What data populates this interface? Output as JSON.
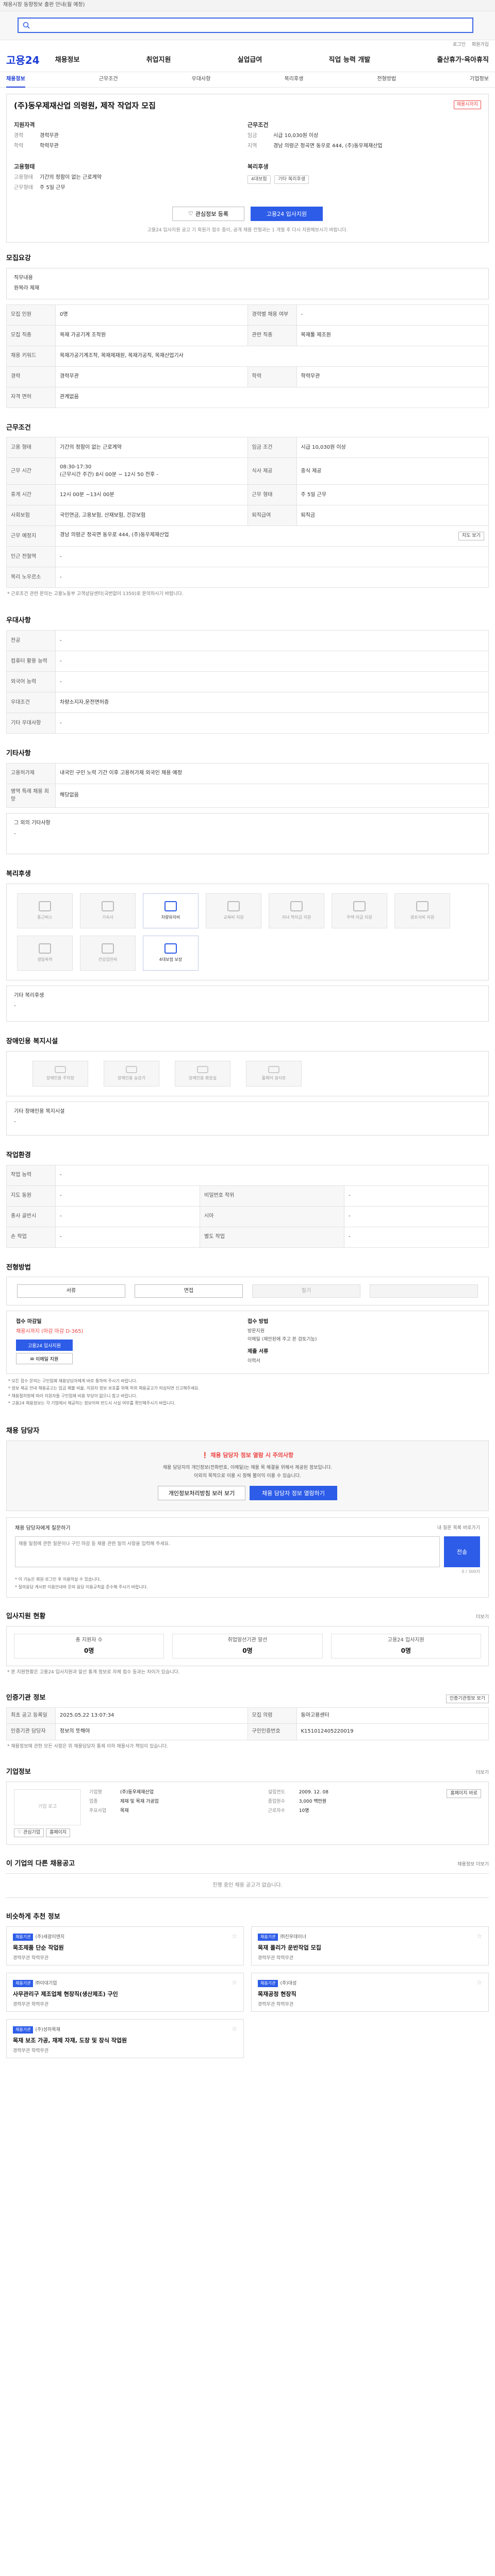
{
  "notice": "채용시장 동향정보 출판 안내(월 예정)",
  "search": {
    "placeholder": ""
  },
  "util": [
    "로그인",
    "회원가입"
  ],
  "logo": "고용24",
  "gnb": [
    "채용정보",
    "취업지원",
    "실업급여",
    "직업 능력 개발",
    "출산휴가·육아휴직"
  ],
  "subnav": [
    {
      "label": "채용정보",
      "active": true
    },
    {
      "label": "근무조건",
      "active": false
    },
    {
      "label": "우대사항",
      "active": false
    },
    {
      "label": "복리후생",
      "active": false
    },
    {
      "label": "전형방법",
      "active": false
    },
    {
      "label": "기업정보",
      "active": false
    }
  ],
  "job": {
    "title": "(주)동우제재산업 의령원, 제작 작업자 모집",
    "badge": "채용시까지",
    "left_head": "지원자격",
    "left": [
      {
        "k": "경력",
        "v": "경력무관"
      },
      {
        "k": "학력",
        "v": "학력무관"
      }
    ],
    "right_head": "근무조건",
    "right": [
      {
        "k": "임금",
        "v": "시급 10,030원 이상"
      },
      {
        "k": "지역",
        "v": "경남 의령군 정곡면 동우로 444, (주)동우제재산업"
      }
    ],
    "left2_head": "고용형태",
    "left2": [
      {
        "k": "고용형태",
        "v": "기간의 정함이 없는 근로계약"
      },
      {
        "k": "근무형태",
        "v": "주 5일 근무"
      }
    ],
    "right2_head": "복리후생",
    "chips": [
      "4대보험",
      "기타 복리후생"
    ],
    "btn_save": "관심정보 등록",
    "btn_apply": "고용24 입사지원",
    "note": "고용24 입사지원 공고 기 회원가 접수 중이, 공개 채용 전형과는 1 개월 후 다시 지원해보시기 바랍니다."
  },
  "sec_recruit": {
    "title": "모집요강",
    "lbl1": "직무내용",
    "val1": "원목라 제재",
    "rows": [
      [
        "모집 인원",
        "0명",
        "경력별 채용 여부",
        "-"
      ],
      [
        "모집 직종",
        "목재 가공기계 조작원",
        "관련 직종",
        "목재툴 제조원"
      ],
      [
        "채용 키워드",
        "목재가공기계조작, 목재제재원, 목재가공직, 목재산업기사",
        "",
        ""
      ],
      [
        "경력",
        "경력무관",
        "학력",
        "학력무관"
      ],
      [
        "자격 면허",
        "관계없음",
        "",
        ""
      ]
    ]
  },
  "sec_cond": {
    "title": "근무조건",
    "rows": [
      [
        "고용 형태",
        "기간의 정함이 없는 근로계약",
        "임금 조건",
        "시급 10,030원 이상"
      ],
      [
        "근무 시간",
        "08:30-17:30\n(근무시간 주간) 8시 00분 ~ 12시 50 전후 -",
        "식사 제공",
        "중식 제공"
      ],
      [
        "휴게 시간",
        "12시 00분 ~13시 00분",
        "근무 형태",
        "주 5일 근무"
      ],
      [
        "사회보험",
        "국민연금, 고용보험, 산재보험, 건강보험",
        "퇴직급여",
        "퇴직금"
      ],
      [
        "근무 예정지",
        "경남 의령군 정곡면 동우로 444, (주)동우제재산업",
        "",
        ""
      ],
      [
        "인근 전철역",
        "-",
        "",
        ""
      ],
      [
        "복리 노우르소",
        "-",
        "",
        ""
      ]
    ],
    "map_btn": "지도 보기",
    "footnote": "* 근로조건 관련 문의는 고용노동부 고객상담센터(국번없이 1350)로 문의하시기 바랍니다."
  },
  "sec_pref": {
    "title": "우대사항",
    "rows": [
      [
        "전공",
        "-"
      ],
      [
        "컴퓨터 활용 능력",
        "-"
      ],
      [
        "외국어 능력",
        "-"
      ],
      [
        "우대조건",
        "차량소지자,운전면허증"
      ],
      [
        "기타 우대사항",
        "-"
      ]
    ]
  },
  "sec_etc": {
    "title": "기타사항",
    "rows": [
      [
        "고용허가제",
        "내국인 구인 노력 기간 이후 고용허가제 외국인 채용 예정"
      ],
      [
        "병역 특례 채용 희망",
        "해당없음"
      ]
    ],
    "extra_lbl": "그 외의 기타사항",
    "extra_val": "-"
  },
  "sec_welfare": {
    "title": "복리후생",
    "items": [
      {
        "t": "통근버스",
        "on": false
      },
      {
        "t": "기숙사",
        "on": false
      },
      {
        "t": "차량유지비",
        "on": true
      },
      {
        "t": "교육비 지원",
        "on": false
      },
      {
        "t": "자녀 학자금 지원",
        "on": false
      },
      {
        "t": "주택 자금 지원",
        "on": false
      },
      {
        "t": "경조사비 지원",
        "on": false
      },
      {
        "t": "생일축하",
        "on": false
      },
      {
        "t": "건강검진비",
        "on": false
      },
      {
        "t": "4대보험 보장",
        "on": true
      }
    ],
    "etc_lbl": "기타 복리후생",
    "etc_val": "-"
  },
  "sec_disabled": {
    "title": "장애인용 복지시설",
    "items": [
      "장애인용 주차장",
      "장애인용 승강기",
      "장애인용 화장실",
      "휠체어 경사로"
    ],
    "etc_lbl": "기타 장애인용 복지시설",
    "etc_val": "-"
  },
  "sec_worktype": {
    "title": "작업환경",
    "rows": [
      [
        "작업 능력",
        "-",
        "",
        ""
      ],
      [
        "지도 동원",
        "-",
        "비밀번호 작위",
        "-"
      ],
      [
        "종사 골반시",
        "-",
        "시아",
        "-"
      ],
      [
        "손 작업",
        "-",
        "별도 작업",
        "-"
      ]
    ]
  },
  "sec_process": {
    "title": "전형방법",
    "steps": [
      {
        "t": "서류",
        "on": true
      },
      {
        "t": "면접",
        "on": true
      },
      {
        "t": "필기",
        "on": false
      },
      {
        "t": "",
        "on": false
      }
    ],
    "apply_h": "접수 마감일",
    "apply_d": "채용시까지 (마감 마감 D-365)",
    "apply_btn": "고용24 입사지원",
    "apply_btn2": "이메일 지원",
    "method_h": "접수 방법",
    "method_p": [
      "방문지원",
      "이메일 (제안된에 주고 본 검토기능)"
    ],
    "docs_h": "제출 서류",
    "docs_p": [
      "이력서"
    ],
    "notes": [
      "* 모든 접수 문의는 구인업체 채용당담자에게 바로 통하여 주시기 바랍니다.",
      "* 정보 제공 안내 채용공고는 임금 체불 비율, 지원자 정보 보호를 위해 허위 채용공고가 의심되면 신고해주세요.",
      "* 채용절차법에 따라 지원자들 구인업체 비용 부담이 없으니 참고 바랍니다.",
      "* 고용24 채용정보는 각 기업에서 제공하는 정보이며 반드시 사실 여부를 확인해주시기 바랍니다."
    ]
  },
  "sec_contact": {
    "title": "채용 담당자",
    "warn": "채용 담당자 정보 열람 시 주의사항",
    "lines": [
      "채용 담당자의 개인정보(전화번호, 이메일)는 채용 목 해결을 위해서 제공된 정보입니다.",
      "이외의 목적으로 이용 시 정해 불이익 이용 수 있습니다."
    ],
    "btn1": "개인정보처리방침 보러 보기",
    "btn2": "채용 담당자 정보 열람하기",
    "qa_title": "채용 담당자에게 질문하기",
    "qa_right": "내 질문 목록 바로가기",
    "qa_placeholder": "채용 일정에 관한 질문이나 구인 마감 등 채용 관련 질의 사항을 입력해 주세요.",
    "qa_btn": "전송",
    "qa_count": "0 / 300자",
    "qa_notes": [
      "* 이 기능은 회원 로그인 후 이용하실 수 있습니다.",
      "* 질의응답 게시판 이용안내와 문의 응답 이용규칙을 준수해 주시기 바랍니다."
    ]
  },
  "sec_status": {
    "title": "입사지원 현황",
    "more": "더보기",
    "items": [
      {
        "t": "총 지원자 수",
        "n": "0명"
      },
      {
        "t": "취업알선기관 알선",
        "n": "0명"
      },
      {
        "t": "고용24 입사지원",
        "n": "0명"
      }
    ],
    "note": "* 본 지원현황은 고용24 입사지원과 알선 통계 정보로 자체 접수 등과는 차이가 있습니다."
  },
  "sec_info": {
    "title": "인증기관 정보",
    "btn": "인증기관정보 보기",
    "rows": [
      [
        "최초 공고 등록일",
        "2025.05.22 13:07:34",
        "모집 의령",
        "동아고용센터"
      ],
      [
        "인증기관 담당자",
        "정보의 뜻해야",
        "구인인증번호",
        "K151012405220019"
      ]
    ],
    "footnote": "* 채용정보에 관한 모든 사항은 위 채용담당자 통제 이하 채용사가 책임이 있습니다."
  },
  "sec_company": {
    "title": "기업정보",
    "more": "더보기",
    "logo_alt": "기업 로고",
    "btn1": "관심기업",
    "btn2": "홈페이지",
    "info_left": [
      {
        "k": "기업명",
        "v": "(주)동우제재산업"
      },
      {
        "k": "업종",
        "v": "제재 및 목재 가공업"
      },
      {
        "k": "주요사업",
        "v": "목재"
      }
    ],
    "info_right": [
      {
        "k": "설립연도",
        "v": "2009. 12. 08"
      },
      {
        "k": "종업원수",
        "v": "3,000 백만원"
      },
      {
        "k": "근로자수",
        "v": "10명"
      }
    ],
    "homepage_btn": "홈페이지 바로"
  },
  "sec_other": {
    "title": "이 기업의 다른 채용공고",
    "more": "채용정보 더보기",
    "empty": "진행 중인 채용 공고가 없습니다."
  },
  "sec_rec": {
    "title": "비슷하게 추천 정보",
    "items": [
      {
        "tag": "채용기관",
        "co": "(주)세광이엔지",
        "title": "목조제품 단순 작업원",
        "meta": "경력무관  학력무관"
      },
      {
        "tag": "채용기관",
        "co": "㈜진우데이너",
        "title": "목재 폴리가 운반작업 모집",
        "meta": "경력무관  학력무관"
      },
      {
        "tag": "채용기관",
        "co": "㈜이대기업",
        "title": "사무관리구 제조업체 현장직(생산제조) 구인",
        "meta": "경력무관  학력무관"
      },
      {
        "tag": "채용기관",
        "co": "(주)대성",
        "title": "목재공정 현장직",
        "meta": "경력무관  학력무관"
      },
      {
        "tag": "채용기관",
        "co": "(주)성하목재",
        "title": "목재 보조 가공, 재제 자재, 도장 및 장식 작업원",
        "meta": "경력무관  학력무관"
      }
    ]
  }
}
